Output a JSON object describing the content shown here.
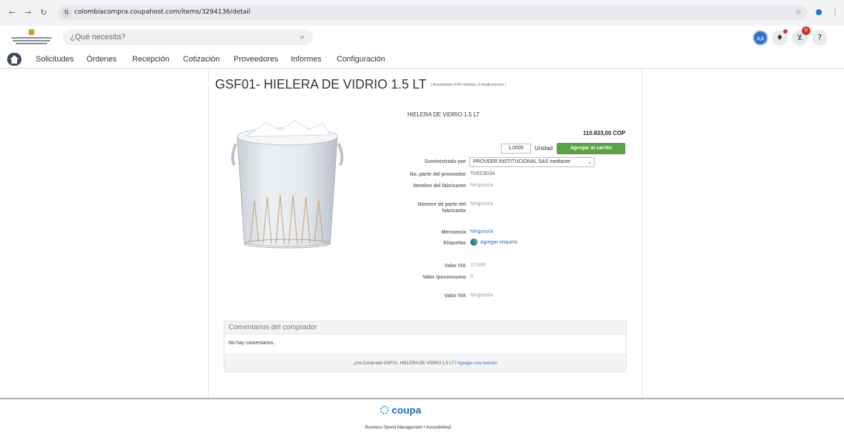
{
  "browser": {
    "url": "colombiacompra.coupahost.com/items/3294136/detail"
  },
  "header": {
    "search_placeholder": "¿Qué necesita?",
    "avatar_initials": "AA",
    "cart_count": "0",
    "help_label": "?"
  },
  "menu": {
    "items": [
      "Solicitudes",
      "Órdenes",
      "Recepción",
      "Cotización",
      "Proveedores",
      "Informes",
      "Configuración"
    ]
  },
  "item": {
    "title": "GSF01- HIELERA DE VIDRIO 1.5 LT",
    "rating_note": "( Actualmente 0.0/5 estrellas, 0 clasificaciones )",
    "description": "HIELERA DE VIDRIO 1.5 LT",
    "price": "110.833,00 COP",
    "quantity": "1,0000",
    "unit": "Unidad",
    "add_to_cart": "Agregar al carrito",
    "fields": {
      "supplied_by_label": "Suministrado por",
      "supplied_by_value": "PROVEER INSTITUCIONAL SAS mediante",
      "supplier_part_label": "No. parte del proveedor",
      "supplier_part_value": "TVEC6034",
      "manufacturer_name_label": "Nombre del fabricante",
      "manufacturer_name_value": "Ninguno/a",
      "manufacturer_part_label": "Número de parte del fabricante",
      "manufacturer_part_value": "Ninguno/a",
      "commodity_label": "Mercancía",
      "commodity_value": "Ninguno/a",
      "tags_label": "Etiquetas",
      "tags_value": "Agregar etiqueta",
      "vat_label": "Valor IVA",
      "vat_value": "17.696",
      "consumption_tax_label": "Valor Ipoconsumo",
      "consumption_tax_value": "0",
      "vat2_label": "Valor IVA",
      "vat2_value": "Ninguno/a"
    }
  },
  "comments": {
    "heading": "Comentarios del comprador",
    "empty": "No hay comentarios.",
    "prompt": "¿Ha Comprado GSF01- HIELERA DE VIDRIO 1.5 LT?",
    "review_link": "Agregar una revisión"
  },
  "footer": {
    "brand": "coupa",
    "links": "Business Spend Management  •  Accesibilidad"
  },
  "colors": {
    "accent_green": "#58a343",
    "link_blue": "#1f6fc5",
    "coupa_blue": "#1e6bb8"
  }
}
